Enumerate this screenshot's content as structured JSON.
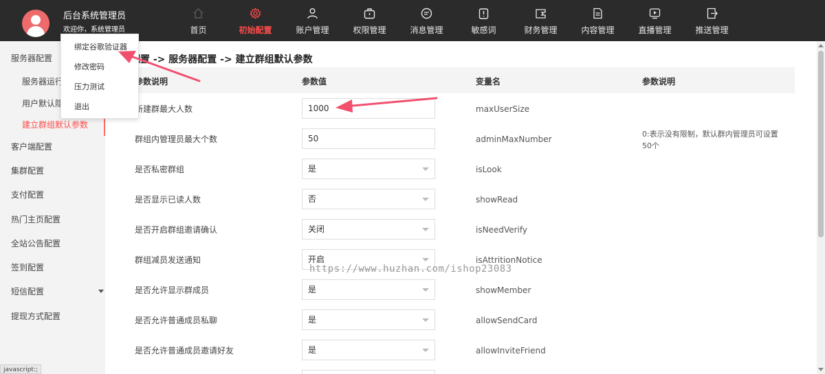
{
  "header": {
    "user_name": "后台系统管理员",
    "greeting": "欢迎你，系统管理员",
    "nav": [
      {
        "label": "首页",
        "icon": "home-icon",
        "active": false
      },
      {
        "label": "初始配置",
        "icon": "gear-icon",
        "active": true
      },
      {
        "label": "账户管理",
        "icon": "user-icon",
        "active": false
      },
      {
        "label": "权限管理",
        "icon": "briefcase-icon",
        "active": false
      },
      {
        "label": "消息管理",
        "icon": "message-icon",
        "active": false
      },
      {
        "label": "敏感词",
        "icon": "alert-icon",
        "active": false
      },
      {
        "label": "财务管理",
        "icon": "wallet-icon",
        "active": false
      },
      {
        "label": "内容管理",
        "icon": "document-icon",
        "active": false
      },
      {
        "label": "直播管理",
        "icon": "play-icon",
        "active": false
      },
      {
        "label": "推送管理",
        "icon": "export-icon",
        "active": false
      }
    ]
  },
  "user_menu": {
    "items": [
      "绑定谷歌验证器",
      "修改密码",
      "压力测试",
      "退出"
    ]
  },
  "sidebar": {
    "items": [
      {
        "label": "服务器配置",
        "level": 1,
        "active": false
      },
      {
        "label": "服务器运行",
        "level": 2,
        "active": false
      },
      {
        "label": "用户默认隐",
        "level": 2,
        "active": false
      },
      {
        "label": "建立群组默认参数",
        "level": 2,
        "active": true
      },
      {
        "label": "客户端配置",
        "level": 1,
        "active": false
      },
      {
        "label": "集群配置",
        "level": 1,
        "active": false
      },
      {
        "label": "支付配置",
        "level": 1,
        "active": false
      },
      {
        "label": "热门主页配置",
        "level": 1,
        "active": false
      },
      {
        "label": "全站公告配置",
        "level": 1,
        "active": false
      },
      {
        "label": "签到配置",
        "level": 1,
        "active": false
      },
      {
        "label": "短信配置",
        "level": 1,
        "active": false,
        "expandable": true
      },
      {
        "label": "提现方式配置",
        "level": 1,
        "active": false
      }
    ]
  },
  "status_hint": "javascript:;",
  "main": {
    "breadcrumb": "始配置 -> 服务器配置 -> 建立群组默认参数",
    "columns": [
      "参数说明",
      "参数值",
      "变量名",
      "参数说明"
    ],
    "rows": [
      {
        "label": "新建群最大人数",
        "type": "input",
        "value": "1000",
        "var": "maxUserSize",
        "desc": ""
      },
      {
        "label": "群组内管理员最大个数",
        "type": "input",
        "value": "50",
        "var": "adminMaxNumber",
        "desc": "0:表示没有限制，默认群内管理员可设置50个"
      },
      {
        "label": "是否私密群组",
        "type": "select",
        "value": "是",
        "var": "isLook",
        "desc": ""
      },
      {
        "label": "是否显示已读人数",
        "type": "select",
        "value": "否",
        "var": "showRead",
        "desc": ""
      },
      {
        "label": "是否开启群组邀请确认",
        "type": "select",
        "value": "关闭",
        "var": "isNeedVerify",
        "desc": ""
      },
      {
        "label": "群组减员发送通知",
        "type": "select",
        "value": "开启",
        "var": "isAttritionNotice",
        "desc": ""
      },
      {
        "label": "是否允许显示群成员",
        "type": "select",
        "value": "是",
        "var": "showMember",
        "desc": ""
      },
      {
        "label": "是否允许普通成员私聊",
        "type": "select",
        "value": "是",
        "var": "allowSendCard",
        "desc": ""
      },
      {
        "label": "是否允许普通成员邀请好友",
        "type": "select",
        "value": "是",
        "var": "allowInviteFriend",
        "desc": ""
      }
    ]
  },
  "watermark": "https://www.huzhan.com/ishop23083",
  "colors": {
    "topbar": "#2b2b2b",
    "accent": "#ff4b4b",
    "annotation_arrow": "#f0506e",
    "sidebar_bg": "#f3f3f3"
  }
}
